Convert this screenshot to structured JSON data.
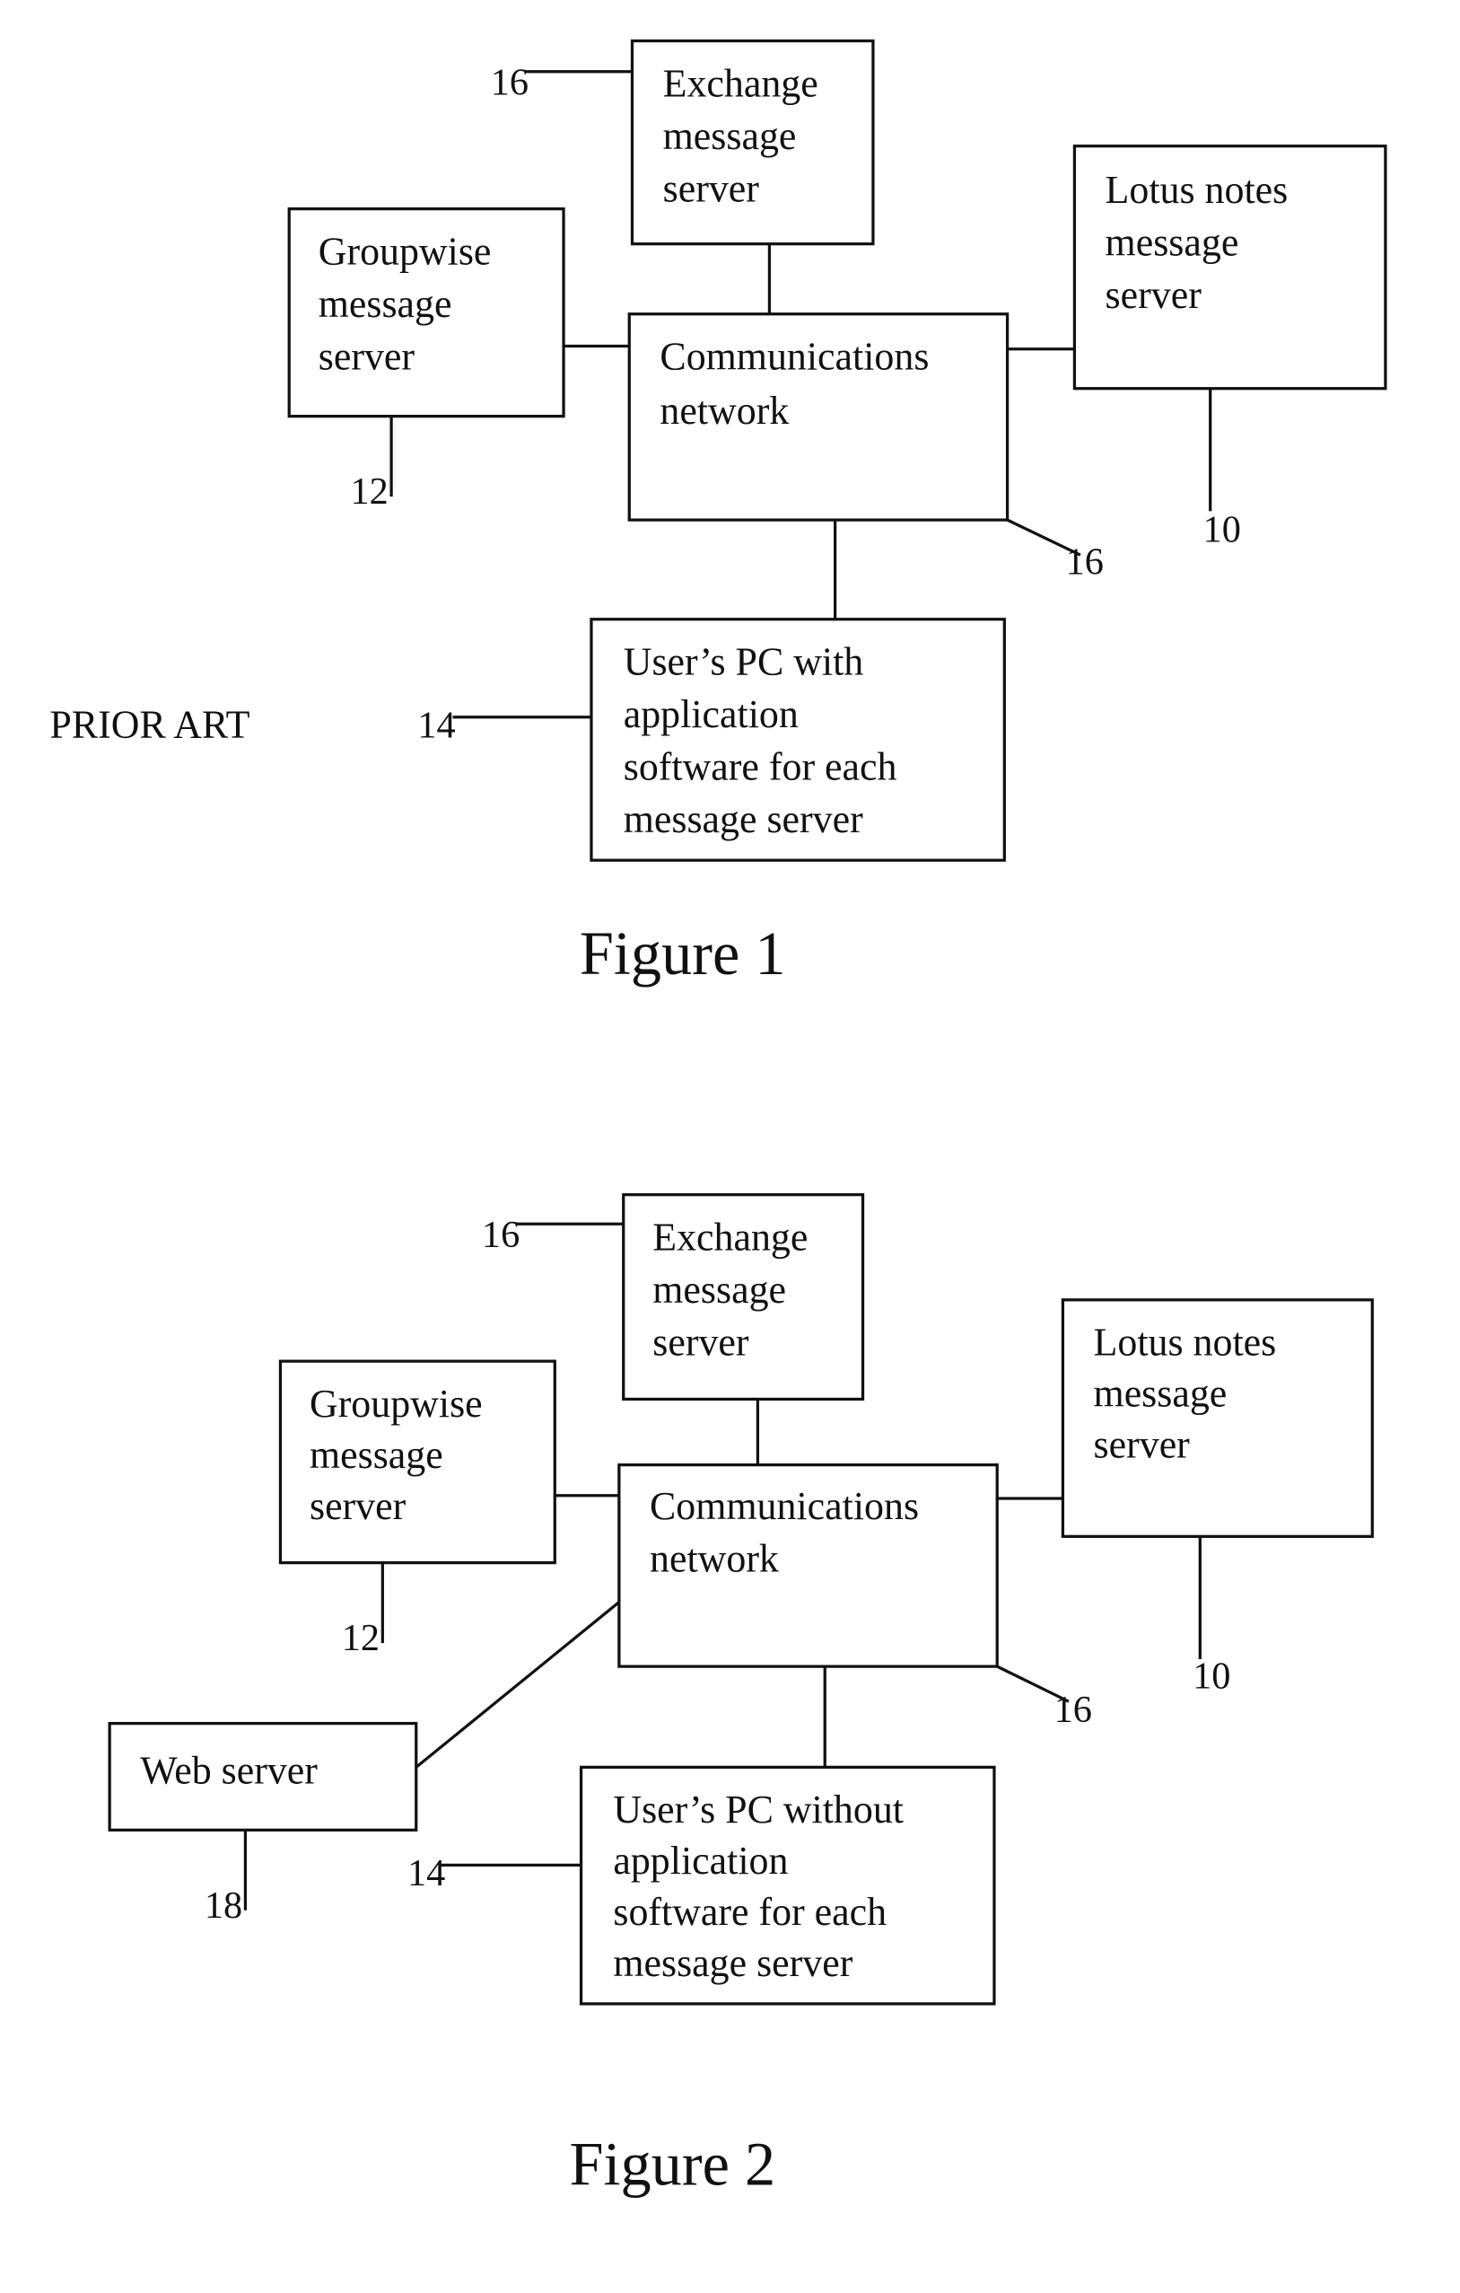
{
  "figure1": {
    "caption": "Figure 1",
    "note": "PRIOR ART",
    "nodes": {
      "exchange": [
        "Exchange",
        "message",
        "server"
      ],
      "groupwise": [
        "Groupwise",
        "message",
        "server"
      ],
      "network": [
        "Communications",
        "network"
      ],
      "lotus": [
        "Lotus notes",
        "message",
        "server"
      ],
      "userpc": [
        "User’s PC with",
        "application",
        "software for each",
        "message server"
      ]
    },
    "refs": {
      "exchange": "16",
      "groupwise": "12",
      "network": "16",
      "lotus": "10",
      "userpc": "14"
    }
  },
  "figure2": {
    "caption": "Figure 2",
    "nodes": {
      "exchange": [
        "Exchange",
        "message",
        "server"
      ],
      "groupwise": [
        "Groupwise",
        "message",
        "server"
      ],
      "network": [
        "Communications",
        "network"
      ],
      "lotus": [
        "Lotus notes",
        "message",
        "server"
      ],
      "webserver": [
        "Web server"
      ],
      "userpc": [
        "User’s PC without",
        "application",
        "software for each",
        "message server"
      ]
    },
    "refs": {
      "exchange": "16",
      "groupwise": "12",
      "network": "16",
      "lotus": "10",
      "webserver": "18",
      "userpc": "14"
    }
  }
}
